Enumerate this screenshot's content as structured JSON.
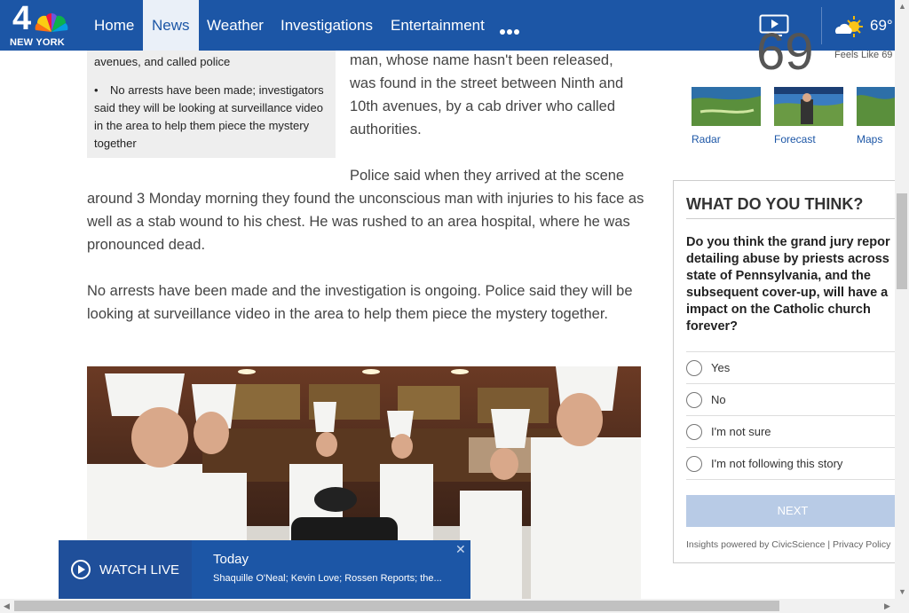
{
  "brand": {
    "channel_number": "4",
    "station": "NEW YORK",
    "colors": {
      "nav_blue": "#1c56a6",
      "poll_button": "#b8cbe6"
    }
  },
  "nav": {
    "items": [
      {
        "label": "Home"
      },
      {
        "label": "News",
        "active": true
      },
      {
        "label": "Weather"
      },
      {
        "label": "Investigations"
      },
      {
        "label": "Entertainment"
      }
    ],
    "more_icon": "ellipsis-icon",
    "video_icon": "video-play-icon",
    "weather_icon": "partly-cloudy-icon",
    "temperature": "69°"
  },
  "article": {
    "sidebar_top": "avenues, and called police",
    "sidebar_bullet": "No arrests have been made; investigators said they will be looking at surveillance video in the area to help them piece the mystery together",
    "p1": "man, whose name hasn't been released, was found in the street between Ninth and 10th avenues, by a cab driver who called authorities.",
    "p2": "Police said when they arrived at the scene around 3 Monday morning they found the unconscious man with injuries to his face as well as a stab wound to his chest. He was rushed to an area hospital, where he was pronounced dead.",
    "p3": "No arrests have been made and the investigation is ongoing. Police said they will be looking at surveillance video in the area to help them piece the mystery together."
  },
  "weather": {
    "big_temp": "69",
    "feels_like": "Feels Like 69",
    "thumbs": [
      {
        "label": "Radar"
      },
      {
        "label": "Forecast"
      },
      {
        "label": "Maps"
      }
    ]
  },
  "poll": {
    "title": "WHAT DO YOU THINK?",
    "question": "Do you think the grand jury repor\ndetailing abuse by priests across\nstate of Pennsylvania, and the\nsubsequent cover-up, will have a\nimpact on the Catholic church\nforever?",
    "options": [
      "Yes",
      "No",
      "I'm not sure",
      "I'm not following this story"
    ],
    "next": "NEXT",
    "footer": "Insights powered by CivicScience | Privacy Policy"
  },
  "watch_live": {
    "label": "WATCH LIVE",
    "show": "Today",
    "description": "Shaquille O'Neal; Kevin Love; Rossen Reports; the...",
    "close": "✕"
  }
}
